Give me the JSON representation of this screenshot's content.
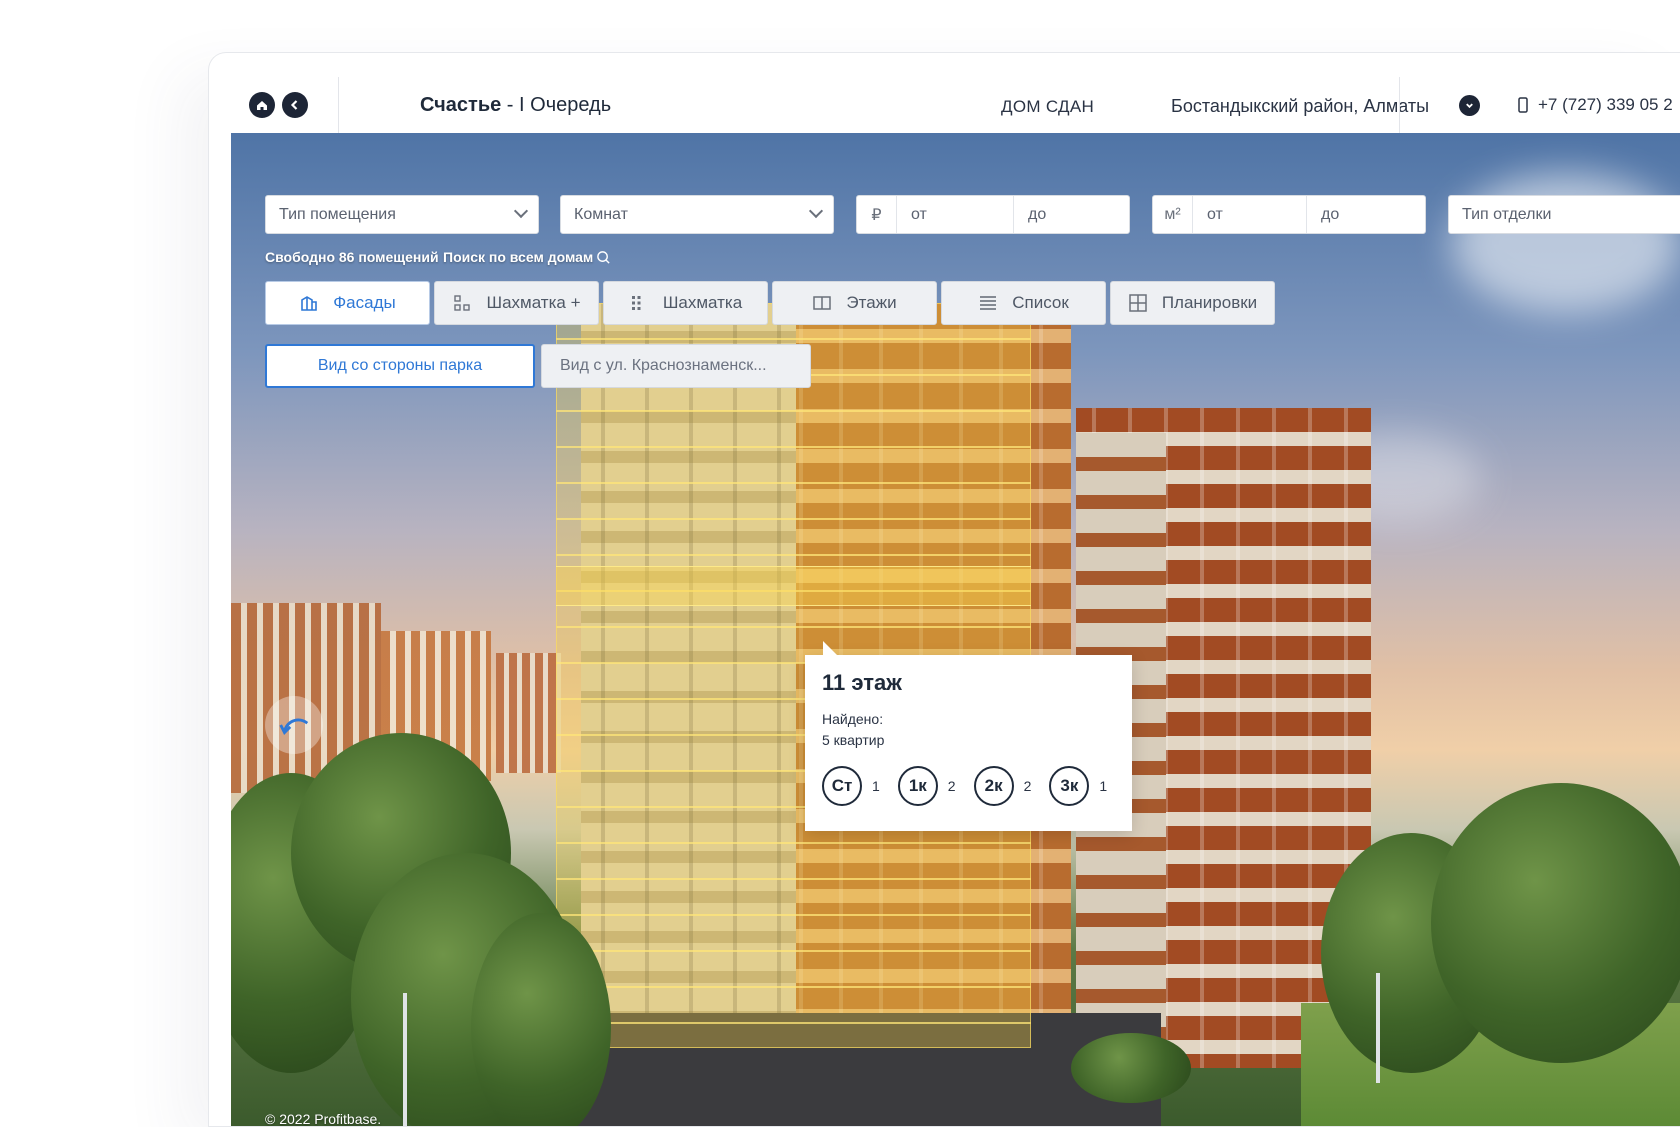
{
  "header": {
    "title_bold": "Счастье",
    "title_rest": " - I Очередь",
    "status": "ДОМ СДАН",
    "district": "Бостандыкский район, Алматы",
    "phone": "+7 (727) 339 05 2"
  },
  "filters": {
    "type_placeholder": "Тип помещения",
    "rooms_placeholder": "Комнат",
    "price_unit": "₽",
    "price_from": "от",
    "price_to": "до",
    "area_unit": "м²",
    "area_from": "от",
    "area_to": "до",
    "finish_placeholder": "Тип отделки"
  },
  "summary": {
    "free": "Свободно 86 помещений",
    "search_all": "Поиск по всем домам"
  },
  "tabs": [
    {
      "label": "Фасады",
      "icon": "facade-icon",
      "active": true
    },
    {
      "label": "Шахматка +",
      "icon": "grid-plus-icon",
      "active": false
    },
    {
      "label": "Шахматка",
      "icon": "grid-dots-icon",
      "active": false
    },
    {
      "label": "Этажи",
      "icon": "floors-icon",
      "active": false
    },
    {
      "label": "Список",
      "icon": "list-icon",
      "active": false
    },
    {
      "label": "Планировки",
      "icon": "layout-icon",
      "active": false
    }
  ],
  "views": [
    {
      "label": "Вид со стороны парка",
      "active": true
    },
    {
      "label": "Вид с ул. Краснознаменск...",
      "active": false
    }
  ],
  "popup": {
    "title": "11 этаж",
    "found_label": "Найдено:",
    "found_count": "5 квартир",
    "chips": [
      {
        "label": "Ст",
        "count": "1"
      },
      {
        "label": "1к",
        "count": "2"
      },
      {
        "label": "2к",
        "count": "2"
      },
      {
        "label": "3к",
        "count": "1"
      }
    ]
  },
  "footer": {
    "copyright": "© 2022 Profitbase."
  },
  "colors": {
    "accent": "#2f78d6",
    "dark": "#1d2536",
    "highlight": "#f3cd46"
  }
}
